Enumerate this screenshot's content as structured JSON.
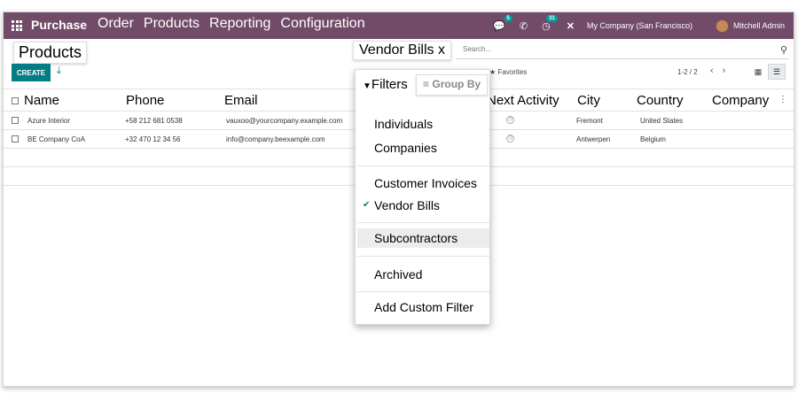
{
  "navbar": {
    "brand": "Purchase",
    "menu": [
      "Order",
      "Products",
      "Reporting",
      "Configuration"
    ],
    "chat_badge": "5",
    "activity_badge": "31",
    "company": "My Company (San Francisco)",
    "user": "Mitchell Admin"
  },
  "control_panel": {
    "page_title": "Products",
    "create_label": "CREATE",
    "search_facet": "Vendor Bills x",
    "search_placeholder": "Search...",
    "favorites_label": "Favorites",
    "pager": "1-2 / 2"
  },
  "table": {
    "columns": [
      "Name",
      "Phone",
      "Email",
      "Next Activity",
      "City",
      "Country",
      "Company"
    ],
    "rows": [
      {
        "name": "Azure Interior",
        "phone": "+58 212 681 0538",
        "email": "vauxoo@yourcompany.example.com",
        "city": "Fremont",
        "country": "United States"
      },
      {
        "name": "BE Company CoA",
        "phone": "+32 470 12 34 56",
        "email": "info@company.beexample.com",
        "city": "Antwerpen",
        "country": "Belgium"
      }
    ]
  },
  "dropdown": {
    "tab_filters": "Filters",
    "tab_groupby": "Group By",
    "items": [
      "Individuals",
      "Companies",
      "Customer Invoices",
      "Vendor Bills",
      "Subcontractors",
      "Archived",
      "Add Custom Filter"
    ]
  },
  "colors": {
    "navbar": "#714b67",
    "accent": "#017e84"
  }
}
